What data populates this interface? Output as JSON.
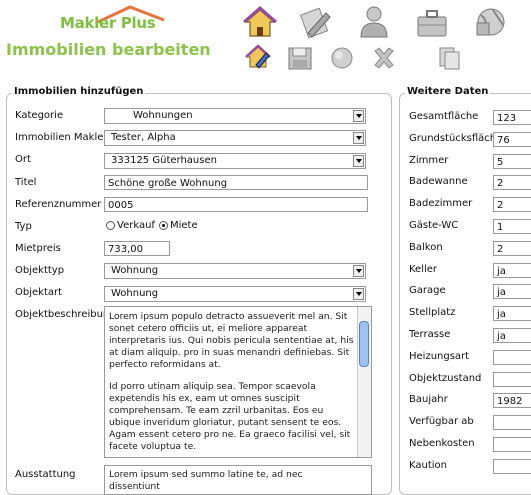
{
  "header": {
    "logo_text": "Makler Plus",
    "page_title": "Immobilien bearbeiten",
    "toolbar_top": [
      "house-icon",
      "edit-document-icon",
      "user-icon",
      "briefcase-icon",
      "globe-icon"
    ],
    "toolbar_bottom": [
      "edit-house-icon",
      "save-icon",
      "circle-icon",
      "close-icon",
      "documents-icon"
    ]
  },
  "form": {
    "legend": "Immobilien hinzufügen",
    "kategorie": {
      "label": "Kategorie",
      "value": "Wohnungen"
    },
    "makler": {
      "label": "Immobilien Makler",
      "value": "Tester, Alpha"
    },
    "ort": {
      "label": "Ort",
      "value": "333125 Güterhausen"
    },
    "titel": {
      "label": "Titel",
      "value": "Schöne große Wohnung"
    },
    "referenznummer": {
      "label": "Referenznummer",
      "value": "0005"
    },
    "typ": {
      "label": "Typ",
      "option1": "Verkauf",
      "option2": "Miete",
      "selected": "Miete"
    },
    "mietpreis": {
      "label": "Mietpreis",
      "value": "733,00"
    },
    "objekttyp": {
      "label": "Objekttyp",
      "value": "Wohnung"
    },
    "objektart": {
      "label": "Objektart",
      "value": "Wohnung"
    },
    "beschreibung": {
      "label": "Objektbeschreibung",
      "para1": "Lorem ipsum populo detracto assueverit mel an. Sit sonet cetero officiis ut, ei meliore appareat interpretaris ius. Qui nobis pericula sententiae at, his at diam aliquip. pro in suas menandri definiebas. Sit perfecto reformidans at.",
      "para2": "Id porro utinam aliquip sea. Tempor scaevola expetendis his ex, eam ut omnes suscipit comprehensam. Te eam zzril urbanitas. Eos eu ubique inveridum gloriatur, putant sensent te eos. Agam essent cetero pro ne. Ea graeco facilisi vel, sit facete voluptua te."
    },
    "ausstattung": {
      "label": "Ausstattung",
      "value": "Lorem ipsum sed summo latine te, ad nec dissentiunt"
    }
  },
  "weitere": {
    "legend": "Weitere Daten",
    "fields": [
      {
        "label": "Gesamtfläche",
        "value": "123"
      },
      {
        "label": "Grundstücksfläche",
        "value": "76"
      },
      {
        "label": "Zimmer",
        "value": "5"
      },
      {
        "label": "Badewanne",
        "value": "2"
      },
      {
        "label": "Badezimmer",
        "value": "2"
      },
      {
        "label": "Gäste-WC",
        "value": "1"
      },
      {
        "label": "Balkon",
        "value": "2"
      },
      {
        "label": "Keller",
        "value": "ja"
      },
      {
        "label": "Garage",
        "value": "ja"
      },
      {
        "label": "Stellplatz",
        "value": "ja"
      },
      {
        "label": "Terrasse",
        "value": "ja"
      },
      {
        "label": "Heizungsart",
        "value": ""
      },
      {
        "label": "Objektzustand",
        "value": ""
      },
      {
        "label": "Baujahr",
        "value": "1982"
      },
      {
        "label": "Verfügbar ab",
        "value": ""
      },
      {
        "label": "Nebenkosten",
        "value": ""
      },
      {
        "label": "Kaution",
        "value": ""
      }
    ]
  },
  "colors": {
    "brand_green": "#8cc34b",
    "accent_orange": "#e8743a"
  }
}
